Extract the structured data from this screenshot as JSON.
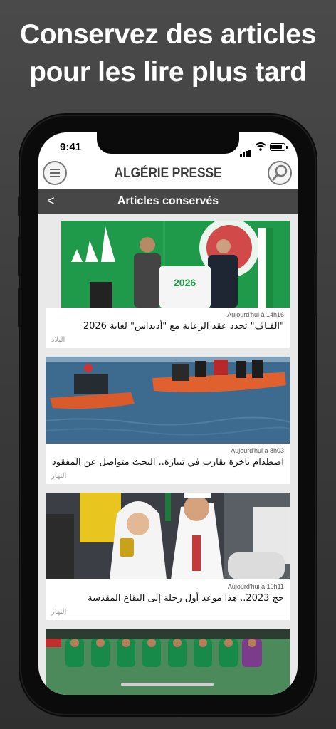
{
  "promo": {
    "line1": "Conservez des articles",
    "line2": "pour les lire plus tard"
  },
  "status_bar": {
    "time": "9:41"
  },
  "app_bar": {
    "logo": "ALGÉRIE PRESSE",
    "menu_icon": "hamburger-menu-icon",
    "search_icon": "magnifier-icon"
  },
  "sub_bar": {
    "back_label": "<",
    "title": "Articles conservés"
  },
  "articles": [
    {
      "timestamp": "Aujourd'hui à 14h16",
      "headline": "\"الفـاف\" تجدد عقد الرعاية مع \"أديداس\" لغاية 2026",
      "source": "البلاد",
      "jersey_number": "2026"
    },
    {
      "timestamp": "Aujourd'hui à 8h03",
      "headline": "اصطدام باخرة بقارب في تيبازة.. البحث متواصل عن المفقود",
      "source": "النهار"
    },
    {
      "timestamp": "Aujourd'hui à 10h11",
      "headline": "حج 2023.. هذا موعد أول رحلة إلى البقاع المقدسة",
      "source": "النهار"
    }
  ],
  "colors": {
    "background": "#3f3f3f",
    "sub_bar": "#474747",
    "feed_bg": "#e9e9e9"
  }
}
